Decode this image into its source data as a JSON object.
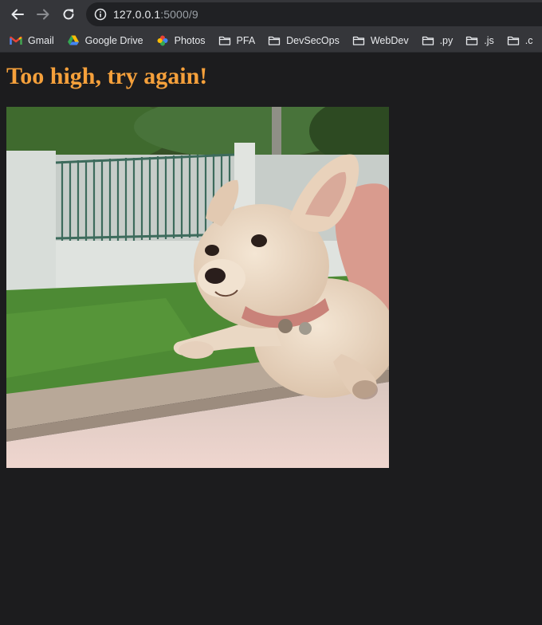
{
  "browser": {
    "url_host": "127.0.0.1",
    "url_path": ":5000/9",
    "back_icon": "arrow-left-icon",
    "forward_icon": "arrow-right-icon",
    "reload_icon": "reload-icon",
    "site_info_icon": "info-circle-icon"
  },
  "bookmarks": [
    {
      "label": "Gmail",
      "icon": "gmail-icon"
    },
    {
      "label": "Google Drive",
      "icon": "google-drive-icon"
    },
    {
      "label": "Photos",
      "icon": "google-photos-icon"
    },
    {
      "label": "PFA",
      "icon": "folder-icon"
    },
    {
      "label": "DevSecOps",
      "icon": "folder-icon"
    },
    {
      "label": "WebDev",
      "icon": "folder-icon"
    },
    {
      "label": ".py",
      "icon": "folder-icon"
    },
    {
      "label": ".js",
      "icon": "folder-icon"
    },
    {
      "label": ".c",
      "icon": "folder-icon"
    }
  ],
  "page": {
    "heading": "Too high, try again!",
    "heading_color": "#f5a03b",
    "background_color": "#1c1c1e"
  }
}
